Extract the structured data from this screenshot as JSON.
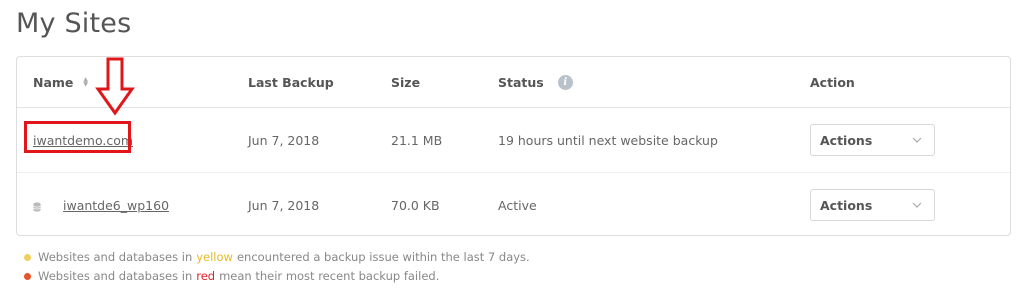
{
  "page": {
    "title": "My Sites"
  },
  "table": {
    "headers": {
      "name": "Name",
      "last_backup": "Last Backup",
      "size": "Size",
      "status": "Status",
      "action": "Action"
    },
    "rows": [
      {
        "name": "iwantdemo.com",
        "last_backup": "Jun 7, 2018",
        "size": "21.1 MB",
        "status": "19 hours until next website backup",
        "action": "Actions"
      },
      {
        "name": "iwantde6_wp160",
        "last_backup": "Jun 7, 2018",
        "size": "70.0 KB",
        "status": "Active",
        "action": "Actions"
      }
    ]
  },
  "legend": {
    "line1": {
      "before": "Websites and databases in",
      "word": "yellow",
      "after": "encountered a backup issue within the last 7 days."
    },
    "line2": {
      "before": "Websites and databases in",
      "word": "red",
      "after": "mean their most recent backup failed."
    }
  },
  "colors": {
    "annotation_red": "#e0161b",
    "yellow": "#e6bb28",
    "red": "#e0242a"
  },
  "icons": {
    "sort": "sort-icon",
    "info": "info-icon",
    "database": "database-icon",
    "chevron": "chevron-down-icon",
    "annotation": "down-arrow-icon"
  }
}
